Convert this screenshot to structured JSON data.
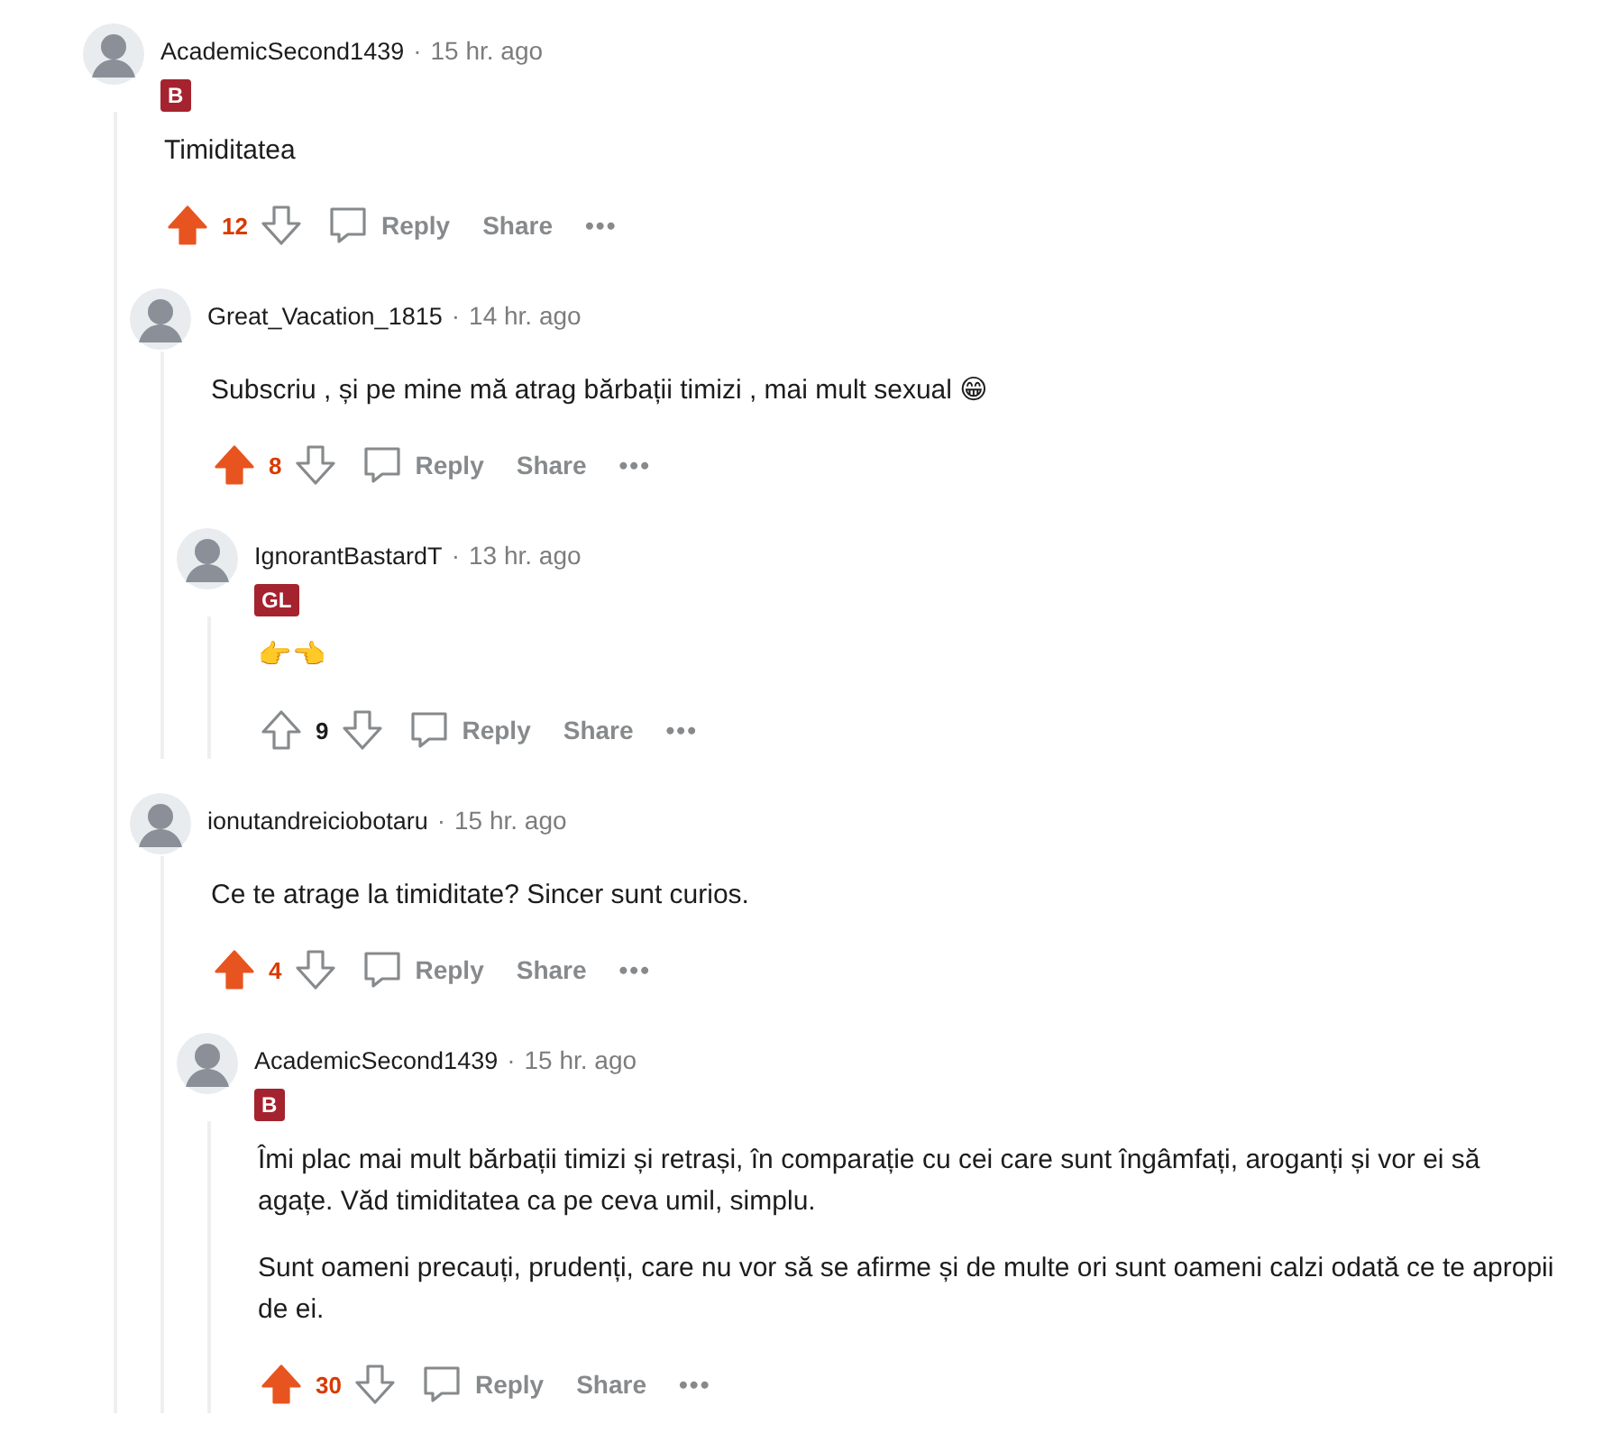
{
  "comments": [
    {
      "author": "AcademicSecond1439",
      "separator": "·",
      "time": "15 hr. ago",
      "flair": "B",
      "paragraphs": [
        "Timiditatea"
      ],
      "upvoted": true,
      "score": "12",
      "actions": {
        "reply": "Reply",
        "share": "Share",
        "more": "•••"
      },
      "children": [
        {
          "author": "Great_Vacation_1815",
          "separator": "·",
          "time": "14 hr. ago",
          "paragraphs": [
            "Subscriu , și pe mine mă atrag bărbații timizi , mai mult sexual 😁"
          ],
          "upvoted": true,
          "score": "8",
          "actions": {
            "reply": "Reply",
            "share": "Share",
            "more": "•••"
          },
          "children": [
            {
              "author": "IgnorantBastardT",
              "separator": "·",
              "time": "13 hr. ago",
              "flair": "GL",
              "paragraphs": [
                "👉👈"
              ],
              "upvoted": false,
              "score": "9",
              "actions": {
                "reply": "Reply",
                "share": "Share",
                "more": "•••"
              }
            }
          ]
        },
        {
          "author": "ionutandreiciobotaru",
          "separator": "·",
          "time": "15 hr. ago",
          "paragraphs": [
            "Ce te atrage la timiditate? Sincer sunt curios."
          ],
          "upvoted": true,
          "score": "4",
          "actions": {
            "reply": "Reply",
            "share": "Share",
            "more": "•••"
          },
          "children": [
            {
              "author": "AcademicSecond1439",
              "separator": "·",
              "time": "15 hr. ago",
              "flair": "B",
              "paragraphs": [
                "Îmi plac mai mult bărbații timizi și retrași, în comparație cu cei care sunt îngâmfați, aroganți și vor ei să agațe. Văd timiditatea ca pe ceva umil, simplu.",
                "Sunt oameni precauți, prudenți, care nu vor să se afirme și de multe ori sunt oameni calzi odată ce te apropii de ei."
              ],
              "upvoted": true,
              "score": "30",
              "actions": {
                "reply": "Reply",
                "share": "Share",
                "more": "•••"
              }
            }
          ]
        }
      ]
    }
  ]
}
